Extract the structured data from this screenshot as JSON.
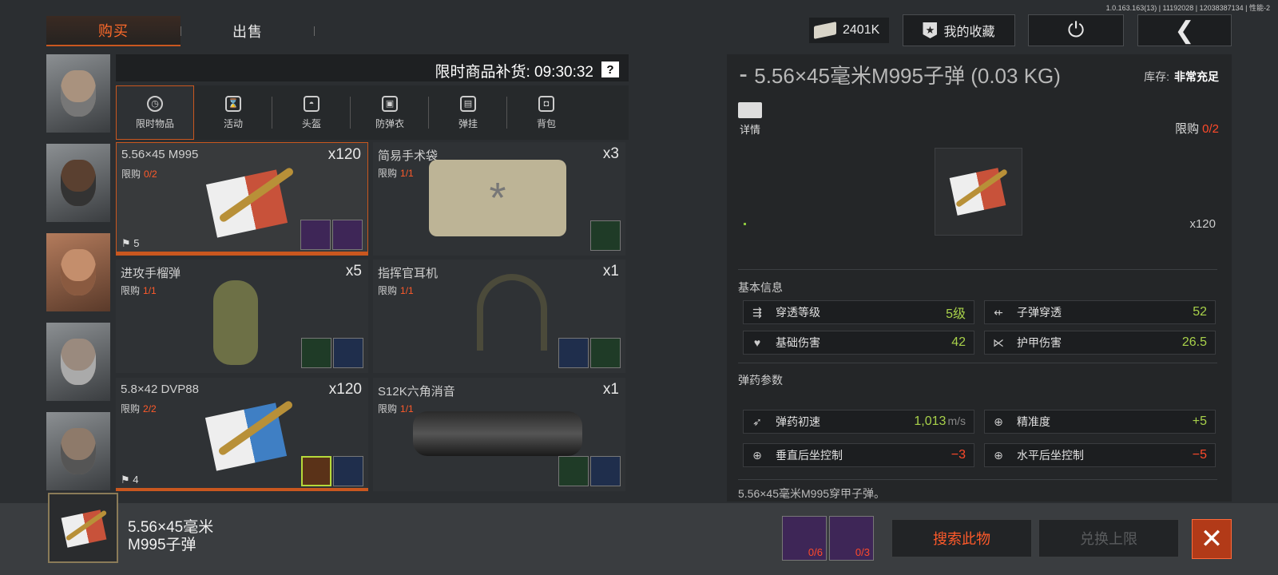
{
  "version": "1.0.163.163(13) | 11192028 | 12038387134 | 性能-2",
  "tabs": {
    "buy": "购买",
    "sell": "出售"
  },
  "money": "2401K",
  "favorites": "我的收藏",
  "power_icon": "⏻",
  "back_icon": "❮",
  "restock": {
    "label": "限时商品补货: 09:30:32",
    "help": "?"
  },
  "categories": [
    {
      "label": "限时物品",
      "icon": "clock-icon"
    },
    {
      "label": "活动",
      "icon": "activity-icon"
    },
    {
      "label": "头盔",
      "icon": "helmet-icon"
    },
    {
      "label": "防弹衣",
      "icon": "vest-icon"
    },
    {
      "label": "弹挂",
      "icon": "rig-icon"
    },
    {
      "label": "背包",
      "icon": "backpack-icon"
    }
  ],
  "items": [
    {
      "name": "5.56×45 M995",
      "qty": "x120",
      "limit_label": "限购",
      "limit": "0/2",
      "count": "5"
    },
    {
      "name": "简易手术袋",
      "qty": "x3",
      "limit_label": "限购",
      "limit": "1/1"
    },
    {
      "name": "进攻手榴弹",
      "qty": "x5",
      "limit_label": "限购",
      "limit": "1/1"
    },
    {
      "name": "指挥官耳机",
      "qty": "x1",
      "limit_label": "限购",
      "limit": "1/1"
    },
    {
      "name": "5.8×42 DVP88",
      "qty": "x120",
      "limit_label": "限购",
      "limit": "2/2",
      "count": "4"
    },
    {
      "name": "S12K六角消音",
      "qty": "x1",
      "limit_label": "限购",
      "limit": "1/1"
    }
  ],
  "detail": {
    "title": "5.56×45毫米M995子弹 (0.03 KG)",
    "stock_label": "库存:",
    "stock_value": "非常充足",
    "details_label": "详情",
    "limit_label": "限购",
    "limit_value": "0/2",
    "qty": "x120",
    "basic_title": "基本信息",
    "stats": [
      {
        "label": "穿透等级",
        "value": "5级"
      },
      {
        "label": "子弹穿透",
        "value": "52"
      },
      {
        "label": "基础伤害",
        "value": "42"
      },
      {
        "label": "护甲伤害",
        "value": "26.5"
      }
    ],
    "ammo_title": "弹药参数",
    "ammo": [
      {
        "label": "弹药初速",
        "value": "1,013",
        "unit": "m/s"
      },
      {
        "label": "精准度",
        "value": "+5"
      },
      {
        "label": "垂直后坐控制",
        "value": "−3"
      },
      {
        "label": "水平后坐控制",
        "value": "−5"
      }
    ],
    "description": "5.56×45毫米M995穿甲子弹。"
  },
  "bottom": {
    "name_line1": "5.56×45毫米",
    "name_line2": "M995子弹",
    "mat1": "0/6",
    "mat2": "0/3",
    "search": "搜索此物",
    "exchange": "兑换上限",
    "close": "✕"
  },
  "colors": {
    "accent": "#c9571f",
    "limit_red": "#ff4a2a",
    "stat_green": "#a8d14a"
  }
}
